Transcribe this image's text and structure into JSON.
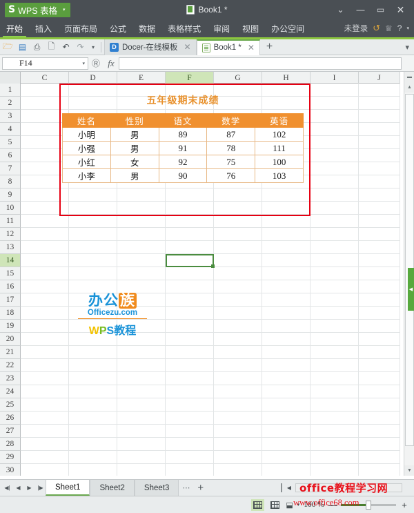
{
  "titlebar": {
    "app_name": "WPS 表格",
    "logo_glyph": "S",
    "dropdown_caret": "▾",
    "document_title": "Book1 *",
    "buttons": {
      "minimize_to_tray": "⌄",
      "minimize": "—",
      "maximize": "▭",
      "close": "✕"
    }
  },
  "ribbon": {
    "tabs": [
      {
        "label": "开始",
        "active": true
      },
      {
        "label": "插入",
        "active": false
      },
      {
        "label": "页面布局",
        "active": false
      },
      {
        "label": "公式",
        "active": false
      },
      {
        "label": "数据",
        "active": false
      },
      {
        "label": "表格样式",
        "active": false
      },
      {
        "label": "审阅",
        "active": false
      },
      {
        "label": "视图",
        "active": false
      },
      {
        "label": "办公空间",
        "active": false
      }
    ],
    "login_status": "未登录",
    "refresh_icon": "↺",
    "skin_icon": "♕",
    "help_icon": "?",
    "help_caret": "▾"
  },
  "toolbar": {
    "icons": [
      {
        "name": "open-icon",
        "glyph": "🗁"
      },
      {
        "name": "save-icon",
        "glyph": "▤"
      },
      {
        "name": "print-icon",
        "glyph": "⎙"
      },
      {
        "name": "print-preview-icon",
        "glyph": "🗋"
      },
      {
        "name": "undo-icon",
        "glyph": "↶"
      },
      {
        "name": "redo-icon",
        "glyph": "↷"
      },
      {
        "name": "toolbar-overflow-icon",
        "glyph": "▾"
      }
    ],
    "doc_tabs": [
      {
        "label": "Docer-在线模板",
        "active": false,
        "close": "✕"
      },
      {
        "label": "Book1 *",
        "active": true,
        "close": "✕"
      }
    ],
    "new_tab": "+",
    "tab_options_icon": "▾"
  },
  "formulabar": {
    "name_box_value": "F14",
    "name_box_caret": "▾",
    "lookup_icon": "Ⓡ",
    "fx_label": "fx",
    "input_value": ""
  },
  "grid": {
    "columns": [
      "C",
      "D",
      "E",
      "F",
      "G",
      "H",
      "I",
      "J"
    ],
    "selected_column": "F",
    "rows": [
      1,
      2,
      3,
      4,
      5,
      6,
      7,
      8,
      9,
      10,
      11,
      12,
      13,
      14,
      15,
      16,
      17,
      18,
      19,
      20,
      21,
      22,
      23,
      24,
      25,
      26,
      27,
      28,
      29,
      30
    ],
    "selected_row": 14,
    "selected_cell": "F14",
    "annotation_color": "#e60012",
    "selection_color": "#4a8c3f"
  },
  "report": {
    "title": "五年级期末成绩",
    "title_color": "#e8912d",
    "header_bg": "#f0902f",
    "headers": [
      "姓名",
      "性别",
      "语文",
      "数学",
      "英语"
    ],
    "rows": [
      [
        "小明",
        "男",
        "89",
        "87",
        "102"
      ],
      [
        "小强",
        "男",
        "91",
        "78",
        "111"
      ],
      [
        "小红",
        "女",
        "92",
        "75",
        "100"
      ],
      [
        "小李",
        "男",
        "90",
        "76",
        "103"
      ]
    ]
  },
  "logo": {
    "line1_a": "办公",
    "line1_b": "族",
    "line2": "Officezu.com",
    "line3_w": "W",
    "line3_p": "P",
    "line3_s": "S",
    "line3_cn": "教程"
  },
  "sheetbar": {
    "nav": {
      "first": "◀|",
      "prev": "◀",
      "next": "▶",
      "last": "|▶"
    },
    "sheets": [
      {
        "label": "Sheet1",
        "active": true
      },
      {
        "label": "Sheet2",
        "active": false
      },
      {
        "label": "Sheet3",
        "active": false
      }
    ],
    "more_dots": "⋯",
    "add_sheet": "+",
    "hscroll_arrow": "◀"
  },
  "statusbar": {
    "view_normal_icon": "▦",
    "view_pagebreak_icon": "▩",
    "page_layout_icon": "⬓",
    "page_layout_caret": "▾",
    "zoom_level": "100 %",
    "zoom_out": "—",
    "zoom_in": "+"
  },
  "watermarks": {
    "top": "office教程学习网",
    "bottom": "www.office68.com",
    "color": "#e8111b"
  }
}
